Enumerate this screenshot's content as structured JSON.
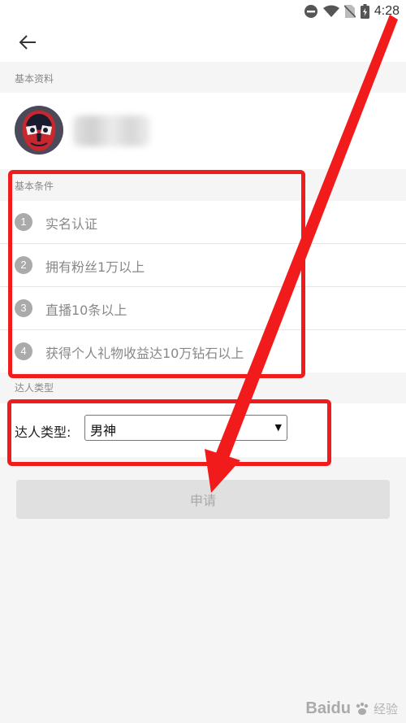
{
  "status_bar": {
    "time": "4:28"
  },
  "sections": {
    "basic_info": "基本资料",
    "basic_conditions": "基本条件",
    "talent_type": "达人类型"
  },
  "conditions": [
    {
      "num": "1",
      "text": "实名认证"
    },
    {
      "num": "2",
      "text": "拥有粉丝1万以上"
    },
    {
      "num": "3",
      "text": "直播10条以上"
    },
    {
      "num": "4",
      "text": "获得个人礼物收益达10万钻石以上"
    }
  ],
  "type_form": {
    "label": "达人类型:",
    "selected": "男神"
  },
  "apply_button": {
    "label": "申请"
  },
  "annotation_color": "#f21b1b",
  "watermark": {
    "brand": "Baidu",
    "sub": "经验"
  }
}
